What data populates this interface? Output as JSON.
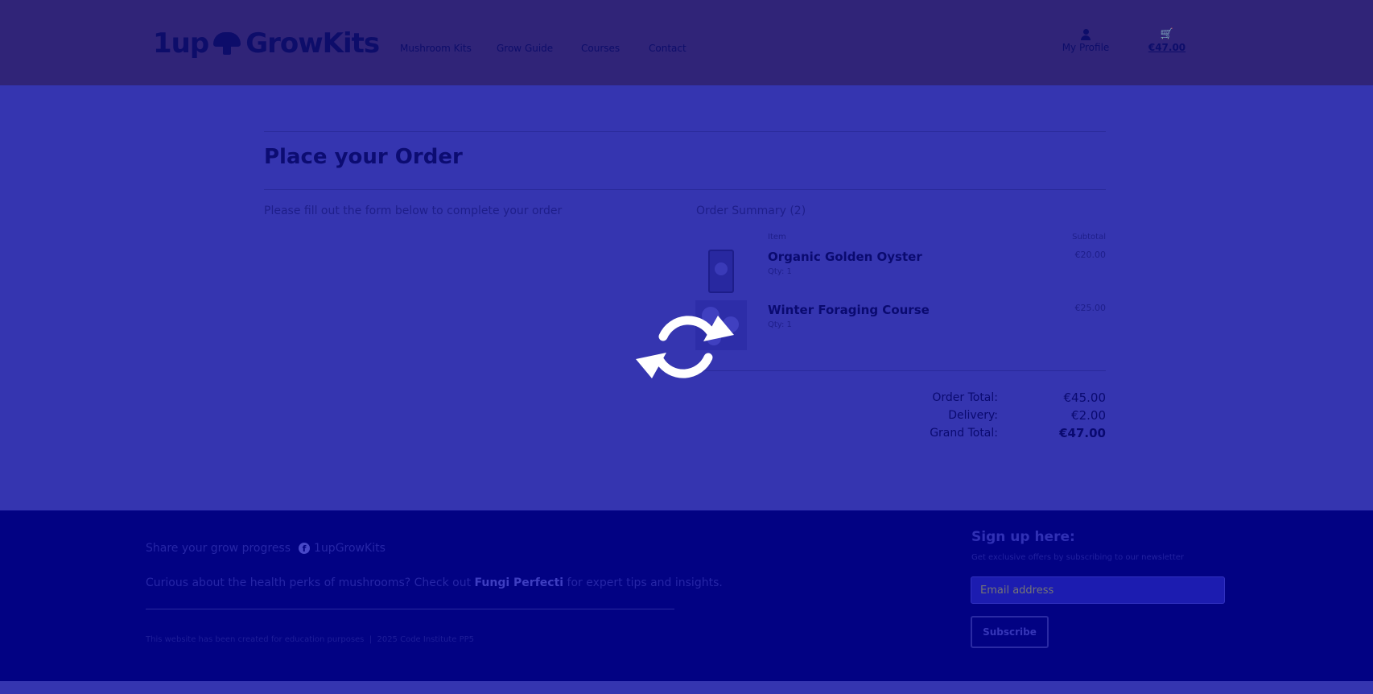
{
  "header": {
    "logo_text_1": "1up",
    "logo_text_2": "GrowKits",
    "nav": [
      "Mushroom Kits",
      "Grow Guide",
      "Courses",
      "Contact"
    ],
    "profile_label": "My Profile",
    "cart_total": "€47.00"
  },
  "main": {
    "title": "Place your Order",
    "intro": "Please fill out the form below to complete your order",
    "summary_title": "Order Summary (2)",
    "col_item": "Item",
    "col_subtotal": "Subtotal",
    "items": [
      {
        "name": "Organic Golden Oyster",
        "qty": "Qty: 1",
        "price": "€20.00"
      },
      {
        "name": "Winter Foraging Course",
        "qty": "Qty: 1",
        "price": "€25.00"
      }
    ],
    "totals": {
      "order_total_label": "Order Total:",
      "order_total": "€45.00",
      "delivery_label": "Delivery:",
      "delivery": "€2.00",
      "grand_total_label": "Grand Total:",
      "grand_total": "€47.00"
    }
  },
  "overlay": {
    "icon": "refresh-icon",
    "color": "#ffffff"
  },
  "footer": {
    "share_text": "Share your grow progress",
    "social_handle": "1upGrowKits",
    "curious_text": "Curious about the health perks of mushrooms? Check out",
    "curious_link": "Fungi Perfecti",
    "curious_end": "for expert tips and insights.",
    "note": "This website has been created for education purposes  |  2025 Code Institute PP5",
    "signup_title": "Sign up here:",
    "signup_sub": "Get exclusive offers by subscribing to our newsletter",
    "email_placeholder": "Email address",
    "subscribe_label": "Subscribe"
  },
  "colors": {
    "header_bg": "#302478",
    "main_bg": "#3535b0",
    "footer_bg": "#020283",
    "text": "#0b0b6e"
  }
}
